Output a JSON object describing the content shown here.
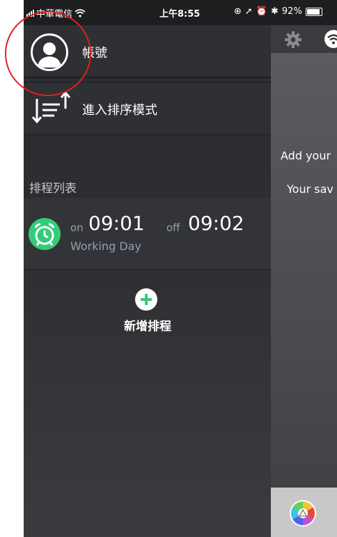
{
  "status_bar": {
    "carrier": "中華電信",
    "time": "上午8:55",
    "battery": "92%",
    "battery_level": 0.92
  },
  "drawer": {
    "account_label": "帳號",
    "sort_mode_label": "進入排序模式",
    "schedule_section_title": "排程列表",
    "schedules": [
      {
        "on_label": "on",
        "on_time": "09:01",
        "off_label": "off",
        "off_time": "09:02",
        "day": "Working Day"
      }
    ],
    "add_schedule_label": "新增排程"
  },
  "main_peek": {
    "add_text": "Add your",
    "saved_text": "Your sav"
  },
  "colors": {
    "drawer_bg": "#2d2e31",
    "accent_green": "#33cc7a",
    "annotation_red": "#e02020"
  },
  "icons": [
    "avatar-icon",
    "sort-icon",
    "alarm-clock-icon",
    "add-icon",
    "gear-icon",
    "wifi-icon",
    "color-wheel-icon"
  ]
}
